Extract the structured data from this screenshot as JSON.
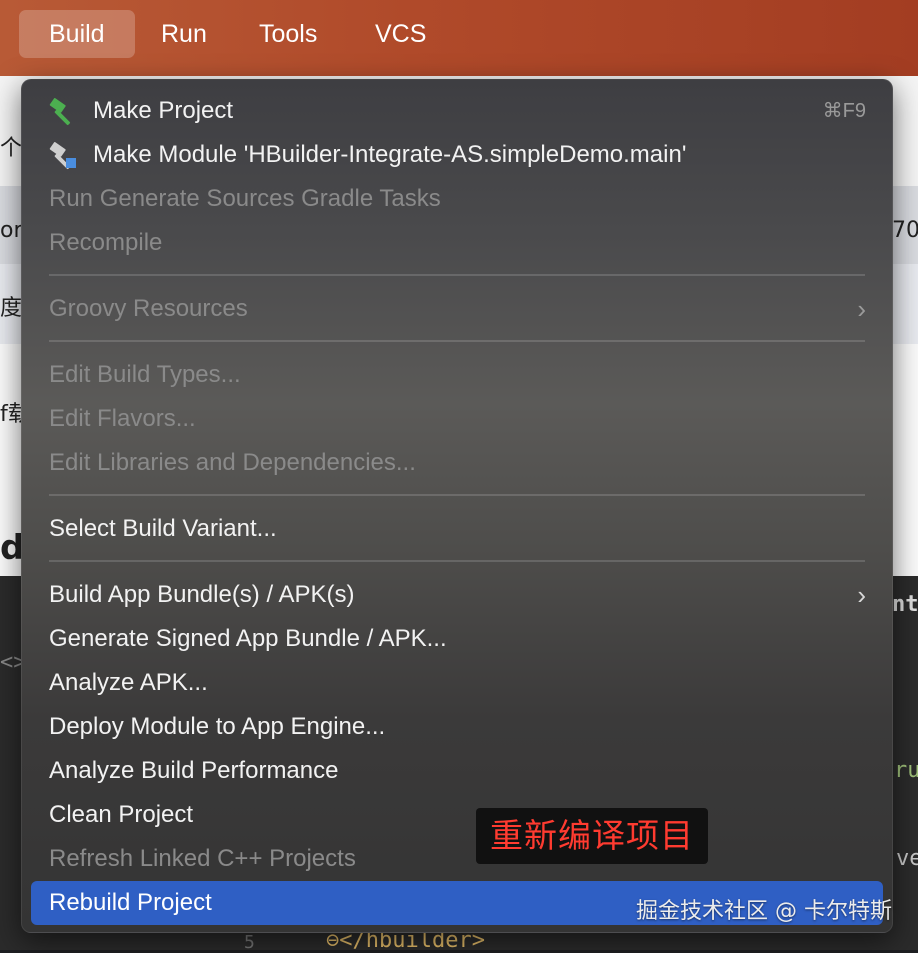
{
  "menubar": {
    "items": [
      {
        "label": "Build",
        "active": true
      },
      {
        "label": "Run"
      },
      {
        "label": "Tools"
      },
      {
        "label": "VCS"
      }
    ]
  },
  "build_menu": {
    "make_project": {
      "label": "Make Project",
      "shortcut": "⌘F9",
      "icon": "hammer-icon"
    },
    "make_module": {
      "label": "Make Module 'HBuilder-Integrate-AS.simpleDemo.main'",
      "icon": "hammer-module-icon"
    },
    "run_generate_sources": {
      "label": "Run Generate Sources Gradle Tasks",
      "disabled": true
    },
    "recompile": {
      "label": "Recompile",
      "disabled": true
    },
    "groovy_resources": {
      "label": "Groovy Resources",
      "disabled": true,
      "submenu": true
    },
    "edit_build_types": {
      "label": "Edit Build Types...",
      "disabled": true
    },
    "edit_flavors": {
      "label": "Edit Flavors...",
      "disabled": true
    },
    "edit_libraries": {
      "label": "Edit Libraries and Dependencies...",
      "disabled": true
    },
    "select_build_variant": {
      "label": "Select Build Variant..."
    },
    "build_app_bundle": {
      "label": "Build App Bundle(s) / APK(s)",
      "submenu": true
    },
    "generate_signed": {
      "label": "Generate Signed App Bundle / APK..."
    },
    "analyze_apk": {
      "label": "Analyze APK..."
    },
    "deploy_module": {
      "label": "Deploy Module to App Engine..."
    },
    "analyze_build_perf": {
      "label": "Analyze Build Performance"
    },
    "clean_project": {
      "label": "Clean Project"
    },
    "refresh_linked": {
      "label": "Refresh Linked C++ Projects",
      "disabled": true
    },
    "rebuild_project": {
      "label": "Rebuild Project",
      "highlighted": true
    }
  },
  "annotation": {
    "text": "重新编译项目",
    "color": "#ff3b30"
  },
  "watermark": {
    "text": "掘金技术社区 @ 卡尔特斯"
  },
  "background": {
    "left_fragments": [
      "个",
      "or",
      "度",
      "f载",
      "dį",
      "<>"
    ],
    "right_fragments": [
      "70",
      "ntı",
      "ru",
      "ve"
    ],
    "bottom_line_number": "5",
    "bottom_code": "⊖</hbuilder>"
  },
  "colors": {
    "menubar": "#b04a2a",
    "highlight": "#2f5fc4",
    "disabled_text": "#8a8a8a"
  }
}
